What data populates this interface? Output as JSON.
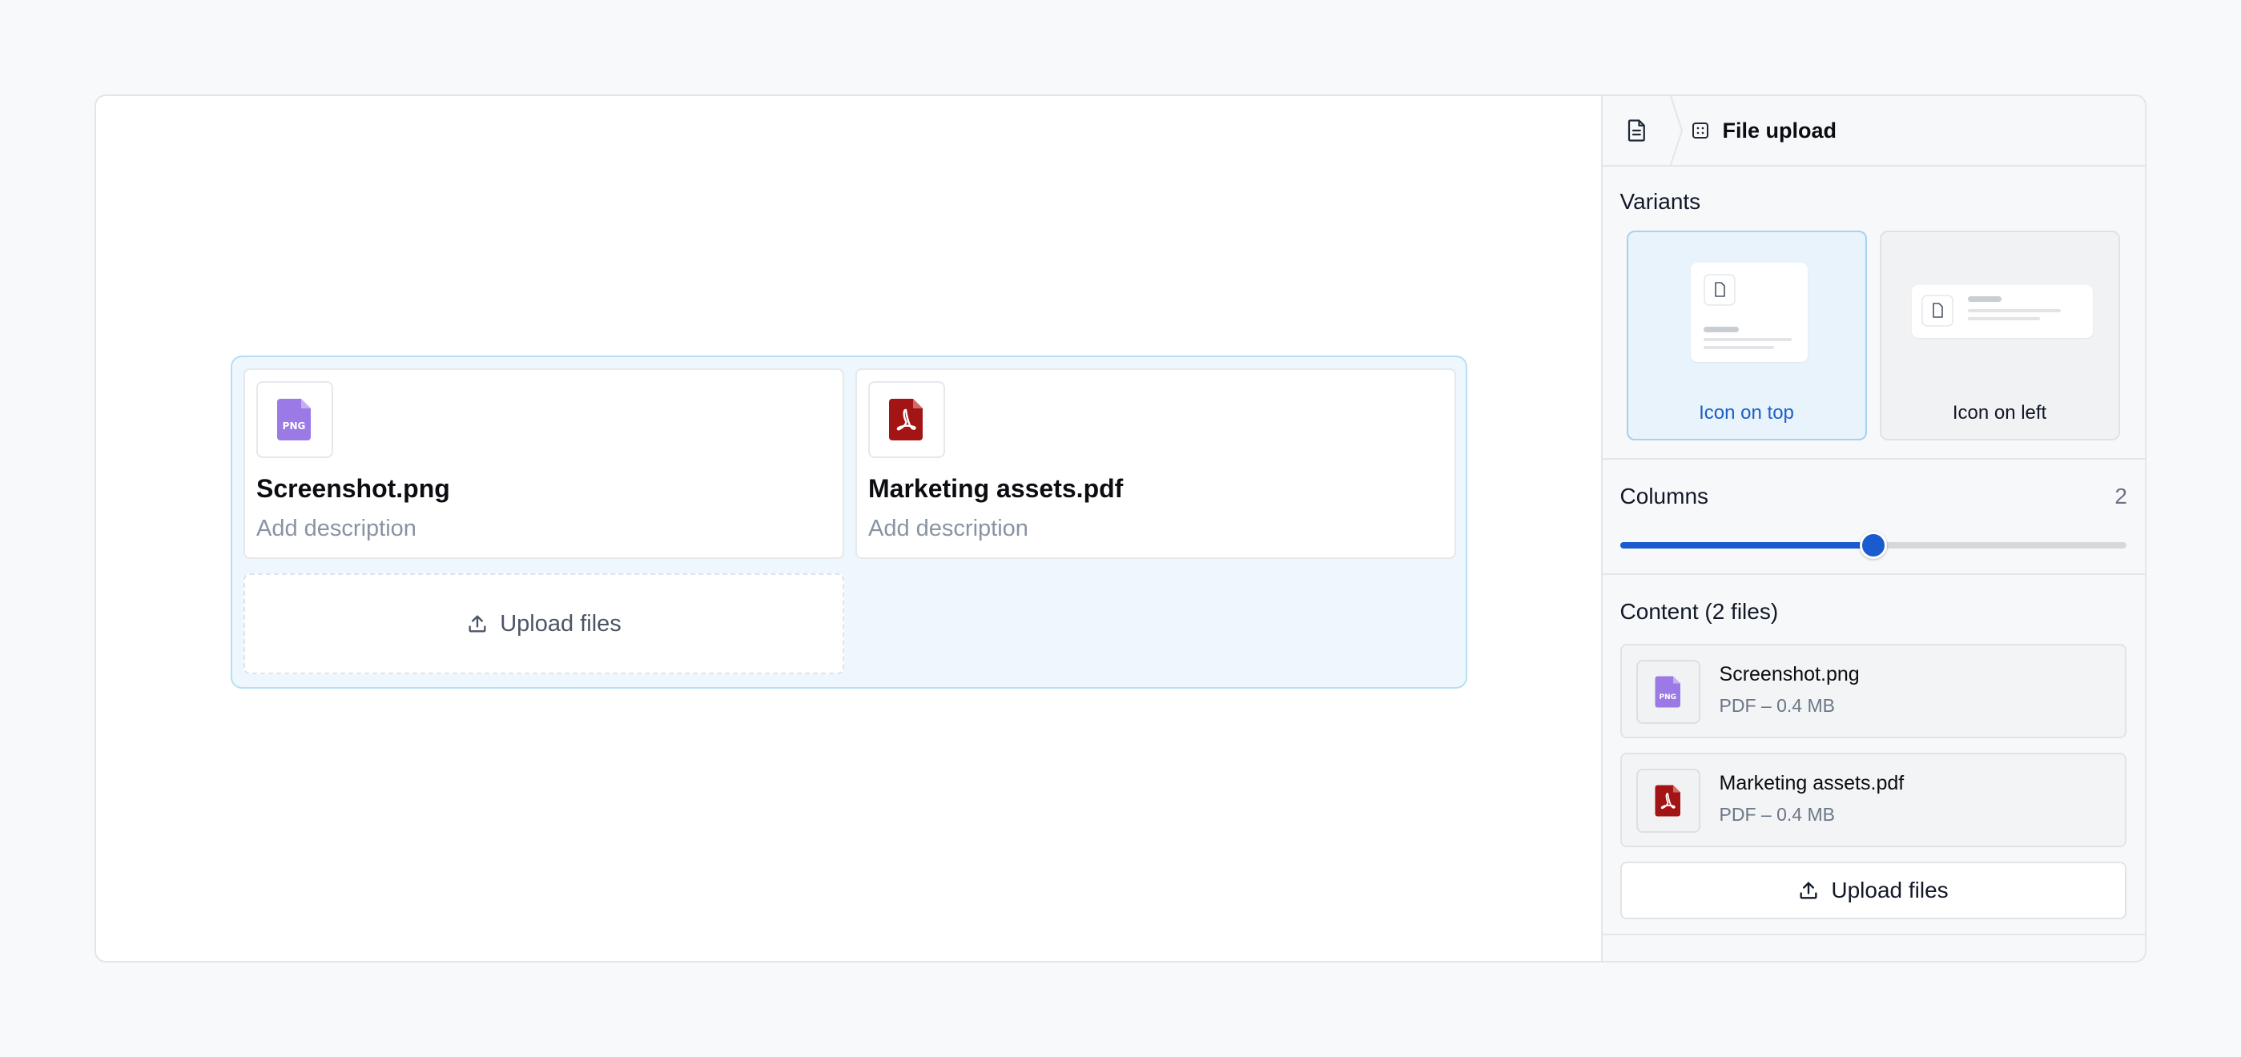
{
  "canvas": {
    "files": [
      {
        "name": "Screenshot.png",
        "description_placeholder": "Add description",
        "type": "png"
      },
      {
        "name": "Marketing assets.pdf",
        "description_placeholder": "Add description",
        "type": "pdf"
      }
    ],
    "upload_label": "Upload files"
  },
  "panel": {
    "breadcrumb": {
      "title": "File upload"
    },
    "variants": {
      "label": "Variants",
      "options": [
        {
          "label": "Icon on top",
          "selected": true
        },
        {
          "label": "Icon on left",
          "selected": false
        }
      ]
    },
    "columns": {
      "label": "Columns",
      "value": "2",
      "slider_fraction": 0.5
    },
    "content": {
      "label": "Content (2 files)",
      "items": [
        {
          "name": "Screenshot.png",
          "meta": "PDF – 0.4 MB",
          "type": "png"
        },
        {
          "name": "Marketing assets.pdf",
          "meta": "PDF – 0.4 MB",
          "type": "pdf"
        }
      ],
      "upload_label": "Upload files"
    }
  },
  "icons": {
    "png_badge_text": "PNG",
    "png_color": "#9b7ae6",
    "pdf_color": "#a31515",
    "accent": "#1a5bcf"
  }
}
